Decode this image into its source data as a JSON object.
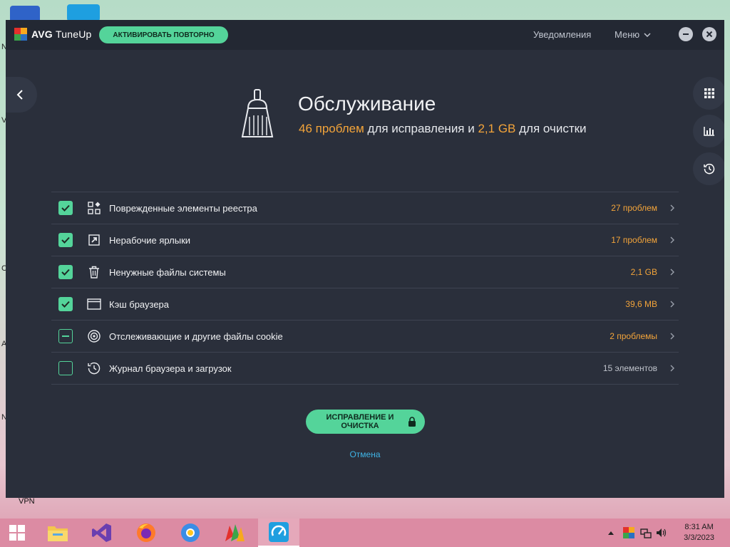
{
  "app": {
    "brand_bold": "AVG",
    "brand_light": "TuneUp",
    "activate_label": "АКТИВИРОВАТЬ ПОВТОРНО",
    "notifications_label": "Уведомления",
    "menu_label": "Меню"
  },
  "header": {
    "title": "Обслуживание",
    "problems_count": "46 проблем",
    "fix_text": "для исправления и",
    "size": "2,1 GB",
    "clean_text": "для очистки"
  },
  "items": [
    {
      "label": "Поврежденные элементы реестра",
      "value": "27 проблем",
      "state": "checked",
      "icon": "registry-icon"
    },
    {
      "label": "Нерабочие ярлыки",
      "value": "17 проблем",
      "state": "checked",
      "icon": "shortcut-icon"
    },
    {
      "label": "Ненужные файлы системы",
      "value": "2,1 GB",
      "state": "checked",
      "icon": "trash-icon"
    },
    {
      "label": "Кэш браузера",
      "value": "39,6 MB",
      "state": "checked",
      "icon": "browser-window-icon"
    },
    {
      "label": "Отслеживающие и другие файлы cookie",
      "value": "2 проблемы",
      "state": "partial",
      "icon": "tracking-icon"
    },
    {
      "label": "Журнал браузера и загрузок",
      "value": "15 элементов",
      "state": "unchecked",
      "icon": "history-icon"
    }
  ],
  "actions": {
    "fix_line1": "ИСПРАВЛЕНИЕ И",
    "fix_line2": "ОЧИСТКА",
    "cancel": "Отмена"
  },
  "desktop": {
    "vpn_label": "VPN",
    "edge_letters": [
      "N",
      "V",
      "C",
      "A",
      "N"
    ]
  },
  "taskbar": {
    "time": "8:31 AM",
    "date": "3/3/2023"
  },
  "colors": {
    "accent_green": "#54d49a",
    "accent_orange": "#f3a43a",
    "link_blue": "#3fb4e6",
    "window_bg": "#2a2f3b"
  }
}
